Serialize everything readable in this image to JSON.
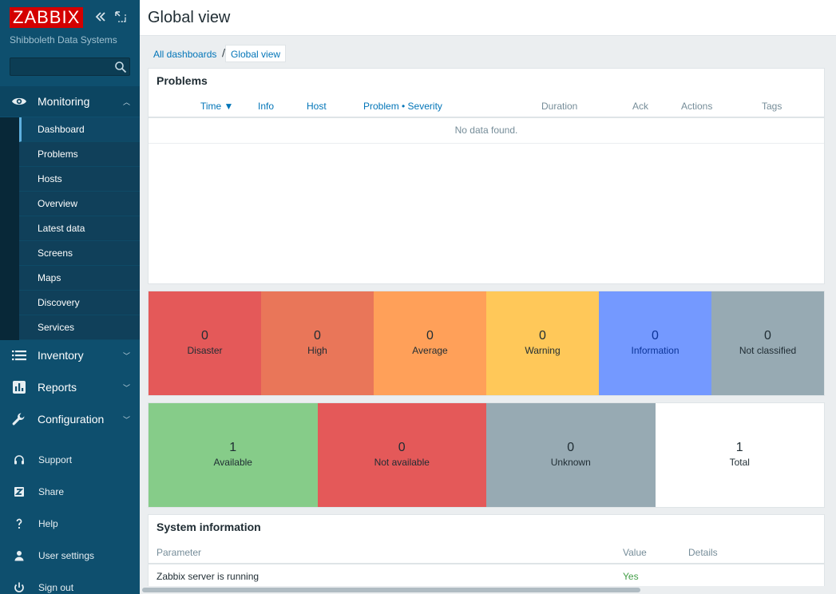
{
  "sidebar": {
    "logo": "ZABBIX",
    "subtitle": "Shibboleth Data Systems",
    "search": {
      "value": "",
      "placeholder": ""
    },
    "sections": [
      {
        "label": "Monitoring",
        "icon": "eye-icon",
        "expanded": true
      },
      {
        "label": "Inventory",
        "icon": "list-icon",
        "expanded": false
      },
      {
        "label": "Reports",
        "icon": "bar-chart-icon",
        "expanded": false
      },
      {
        "label": "Configuration",
        "icon": "wrench-icon",
        "expanded": false
      }
    ],
    "monitoring_items": [
      "Dashboard",
      "Problems",
      "Hosts",
      "Overview",
      "Latest data",
      "Screens",
      "Maps",
      "Discovery",
      "Services"
    ],
    "selected_item": "Dashboard",
    "footer": [
      {
        "label": "Support",
        "icon": "headset-icon"
      },
      {
        "label": "Share",
        "icon": "share-z-icon"
      },
      {
        "label": "Help",
        "icon": "question-icon"
      },
      {
        "label": "User settings",
        "icon": "user-icon"
      },
      {
        "label": "Sign out",
        "icon": "power-icon"
      }
    ]
  },
  "header": {
    "title": "Global view"
  },
  "breadcrumb": {
    "parent": "All dashboards",
    "separator": "/",
    "current": "Global view"
  },
  "problems_widget": {
    "title": "Problems",
    "columns": [
      "Time ▼",
      "Info",
      "Host",
      "Problem • Severity",
      "Duration",
      "Ack",
      "Actions",
      "Tags"
    ],
    "empty_text": "No data found."
  },
  "severity_tiles": [
    {
      "count": "0",
      "label": "Disaster",
      "color": "#e45959",
      "text_color": "#1f2c33"
    },
    {
      "count": "0",
      "label": "High",
      "color": "#e97659",
      "text_color": "#1f2c33"
    },
    {
      "count": "0",
      "label": "Average",
      "color": "#ffa059",
      "text_color": "#1f2c33"
    },
    {
      "count": "0",
      "label": "Warning",
      "color": "#ffc859",
      "text_color": "#1f2c33"
    },
    {
      "count": "0",
      "label": "Information",
      "color": "#7499ff",
      "text_color": "#0b3499"
    },
    {
      "count": "0",
      "label": "Not classified",
      "color": "#97aab3",
      "text_color": "#1f2c33"
    }
  ],
  "host_tiles": [
    {
      "count": "1",
      "label": "Available",
      "color": "#86cc89"
    },
    {
      "count": "0",
      "label": "Not available",
      "color": "#e45959"
    },
    {
      "count": "0",
      "label": "Unknown",
      "color": "#97aab3"
    },
    {
      "count": "1",
      "label": "Total",
      "color": "#ffffff"
    }
  ],
  "system_info": {
    "title": "System information",
    "columns": [
      "Parameter",
      "Value",
      "Details"
    ],
    "rows": [
      {
        "parameter": "Zabbix server is running",
        "value": "Yes",
        "value_color": "#429e47",
        "details": ""
      }
    ]
  }
}
